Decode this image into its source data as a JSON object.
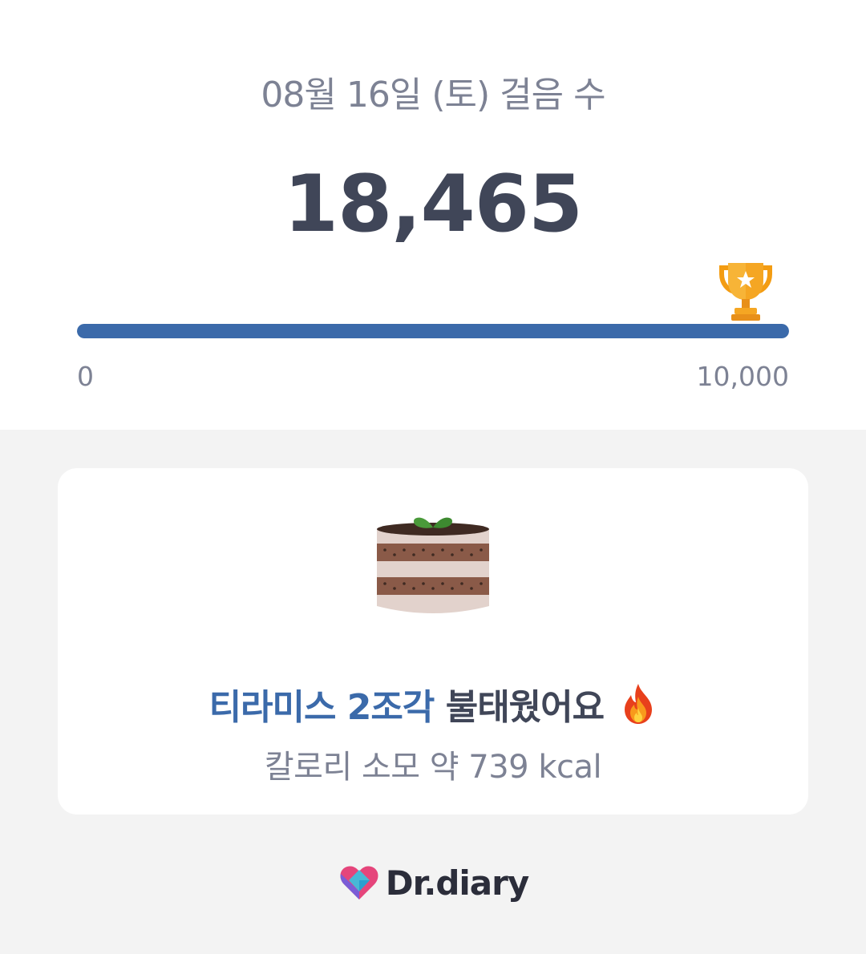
{
  "header": {
    "title": "08월 16일 (토) 걸음 수",
    "step_count": "18,465"
  },
  "progress": {
    "min_label": "0",
    "max_label": "10,000",
    "fraction": 1.0,
    "goal_icon": "trophy-icon"
  },
  "reward_card": {
    "food_icon": "tiramisu-cake-icon",
    "highlight": "티라미스 2조각",
    "suffix": " 불태웠어요 ",
    "emoji_icon": "fire-icon",
    "calorie_text": "칼로리 소모 약 739 kcal"
  },
  "brand": {
    "logo_icon": "heart-logo-icon",
    "name": "Dr.diary"
  },
  "colors": {
    "accent": "#3b6aaa",
    "text_dark": "#404658",
    "text_muted": "#7d8294",
    "background": "#f3f3f3"
  }
}
